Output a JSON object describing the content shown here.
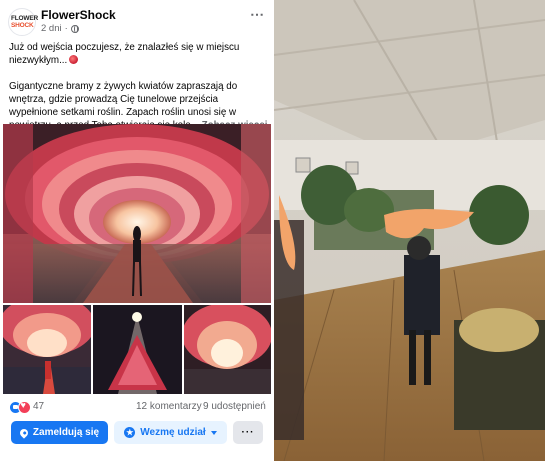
{
  "post": {
    "page_name": "FlowerShock",
    "avatar_logo_line1": "FLOWER",
    "avatar_logo_line2": "SHOCK",
    "time": "2 dni",
    "time_separator": "·",
    "text_line1": "Już od wejścia poczujesz, że znalazłeś się w miejscu niezwykłym...",
    "text_line2": "Gigantyczne bramy z żywych kwiatów zapraszają do wnętrza, gdzie prowadzą Cię tunelowe przejścia wypełnione setkami roślin. Zapach roślin unosi się w powietrzu, a przed Tobą otwierają się kole...",
    "see_more": "Zobacz więcej",
    "more_icon": "⋯",
    "reaction_count": "47",
    "comments": "12 komentarzy",
    "shares": "9 udostępnień",
    "checkin_label": "Zameldują się",
    "interest_label": "Wezmę udział",
    "more_button": "···"
  },
  "icons": {
    "globe": "globe-icon",
    "like": "like-icon",
    "love": "love-icon",
    "rose": "rose-icon",
    "pin": "map-pin-icon",
    "star": "star-icon",
    "caret": "chevron-down-icon"
  },
  "colors": {
    "accent": "#1877f2",
    "accent_light": "#e7f3ff",
    "secondary_text": "#65676b",
    "love": "#f33e58"
  }
}
